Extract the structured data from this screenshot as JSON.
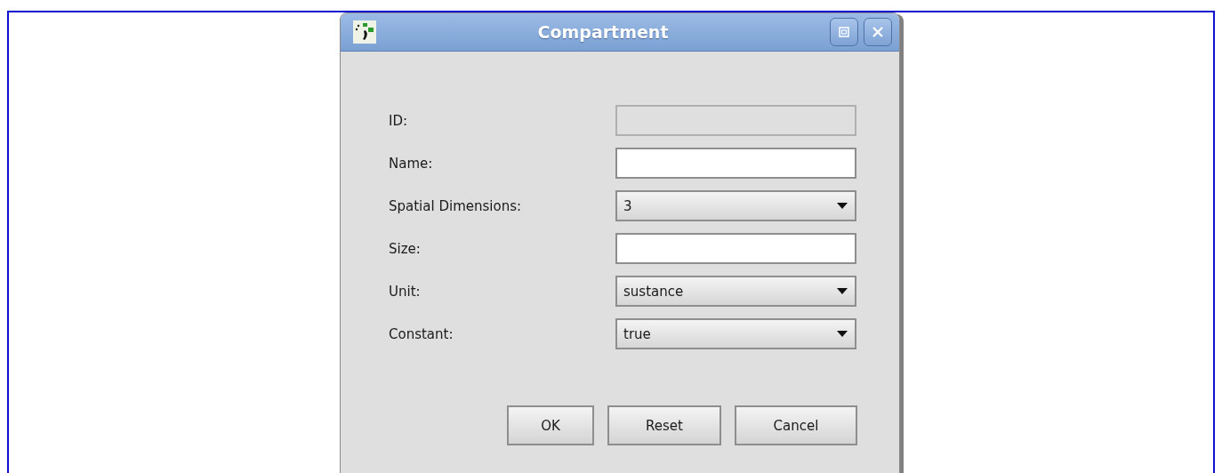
{
  "window": {
    "title": "Compartment"
  },
  "fields": [
    {
      "label": "ID:",
      "kind": "text",
      "disabled": true
    },
    {
      "label": "Name:",
      "kind": "text",
      "disabled": false
    },
    {
      "label": "Spatial Dimensions:",
      "kind": "combo",
      "value": "3",
      "disabled": false
    },
    {
      "label": "Size:",
      "kind": "text",
      "disabled": false
    },
    {
      "label": "Unit:",
      "kind": "combo",
      "value": "sustance",
      "disabled": false
    },
    {
      "label": "Constant:",
      "kind": "combo",
      "value": "true",
      "disabled": false
    }
  ],
  "buttons": [
    "OK",
    "Reset",
    "Cancel"
  ]
}
